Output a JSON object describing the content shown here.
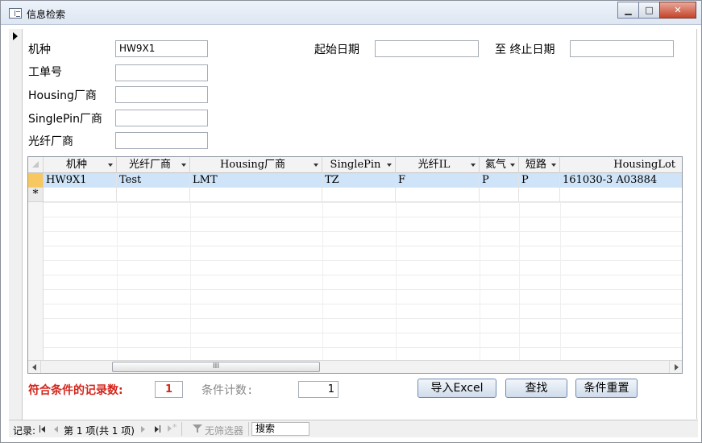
{
  "window": {
    "title": "信息检索",
    "minimize_glyph": "▁",
    "maximize_glyph": "□",
    "close_glyph": "✕"
  },
  "form": {
    "model_label": "机种",
    "model_value": "HW9X1",
    "workorder_label": "工单号",
    "workorder_value": "",
    "housing_vendor_label": "Housing厂商",
    "housing_vendor_value": "",
    "singlepin_vendor_label": "SinglePin厂商",
    "singlepin_vendor_value": "",
    "fiber_vendor_label": "光纤厂商",
    "fiber_vendor_value": "",
    "start_date_label": "起始日期",
    "start_date_value": "",
    "end_date_label": "至 终止日期",
    "end_date_value": ""
  },
  "grid": {
    "columns": [
      "机种",
      "光纤厂商",
      "Housing厂商",
      "SinglePin",
      "光纤IL",
      "氦气",
      "短路",
      "HousingLot"
    ],
    "rows": [
      [
        "HW9X1",
        "Test",
        "LMT",
        "TZ",
        "F",
        "P",
        "P",
        "161030-3 A03884"
      ]
    ],
    "new_row_marker": "*",
    "scroll_thumb_glyph": "III"
  },
  "footer": {
    "match_count_label": "符合条件的记录数:",
    "match_count_value": "1",
    "condition_count_label": "条件计数:",
    "condition_count_value": "1",
    "import_button": "导入Excel",
    "search_button": "查找",
    "reset_button": "条件重置"
  },
  "statusbar": {
    "record_label": "记录:",
    "position_text": "第 1 项(共 1 项)",
    "filter_text": "无筛选器",
    "search_text": "搜索"
  },
  "colors": {
    "accent_red": "#d4261c",
    "selected_row": "#cfe4f8",
    "current_record_marker": "#f6c85f"
  }
}
